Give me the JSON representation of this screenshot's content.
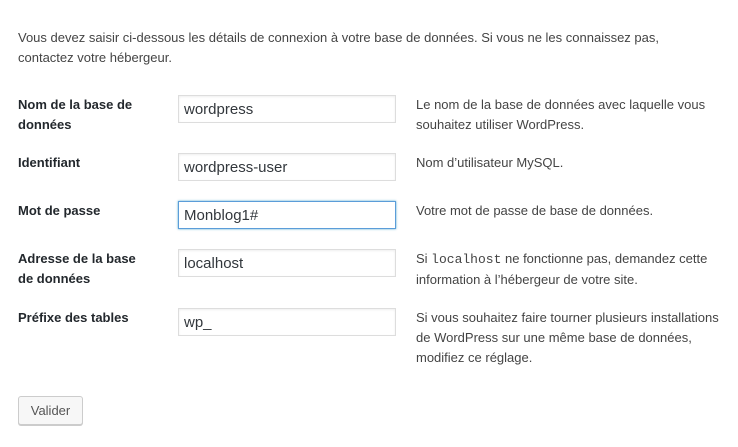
{
  "intro": "Vous devez saisir ci-dessous les détails de connexion à votre base de données. Si vous ne les connaissez pas, contactez votre hébergeur.",
  "fields": [
    {
      "label_line1": "Nom de la base de",
      "label_line2": "données",
      "value": "wordpress",
      "desc": "Le nom de la base de données avec laquelle vous souhaitez utiliser WordPress."
    },
    {
      "label_line1": "Identifiant",
      "label_line2": "",
      "value": "wordpress-user",
      "desc": "Nom d’utilisateur MySQL."
    },
    {
      "label_line1": "Mot de passe",
      "label_line2": "",
      "value": "Monblog1#",
      "desc": "Votre mot de passe de base de données."
    },
    {
      "label_line1": "Adresse de la base",
      "label_line2": "de données",
      "value": "localhost",
      "desc_pre": "Si ",
      "desc_code": "localhost",
      "desc_post": " ne fonctionne pas, demandez cette information à l’hébergeur de votre site."
    },
    {
      "label_line1": "Préfixe des tables",
      "label_line2": "",
      "value": "wp_",
      "desc": "Si vous souhaitez faire tourner plusieurs installations de WordPress sur une même base de données, modifiez ce réglage."
    }
  ],
  "submit_label": "Valider",
  "colors": {
    "text": "#444444",
    "label": "#23282d",
    "focus_border": "#5b9dd9",
    "button_bg": "#f7f7f7"
  }
}
